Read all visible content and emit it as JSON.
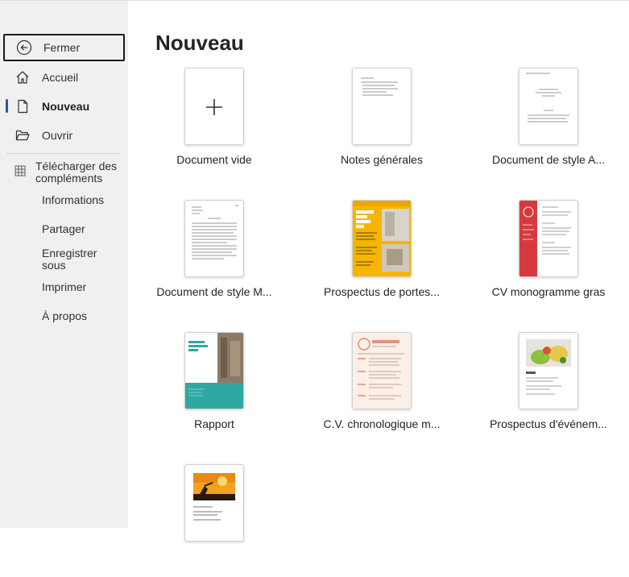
{
  "sidebar": {
    "items": [
      {
        "label": "Fermer",
        "icon": "back-arrow-icon"
      },
      {
        "label": "Accueil",
        "icon": "home-icon"
      },
      {
        "label": "Nouveau",
        "icon": "new-document-icon"
      },
      {
        "label": "Ouvrir",
        "icon": "folder-open-icon"
      }
    ],
    "addins": {
      "label": "Télécharger des compléments",
      "icon": "addins-grid-icon"
    },
    "secondary": [
      "Informations",
      "Partager",
      "Enregistrer sous",
      "Imprimer",
      "À propos"
    ]
  },
  "main": {
    "title": "Nouveau",
    "templates": [
      {
        "name": "Document vide"
      },
      {
        "name": "Notes générales"
      },
      {
        "name": "Document de style A..."
      },
      {
        "name": "Document de style M..."
      },
      {
        "name": "Prospectus de portes..."
      },
      {
        "name": "CV monogramme gras"
      },
      {
        "name": "Rapport"
      },
      {
        "name": "C.V. chronologique m..."
      },
      {
        "name": "Prospectus d'événem..."
      },
      {
        "name": ""
      }
    ]
  },
  "colors": {
    "sidebar_bg": "#f0f0f0",
    "accent": "#2b579a",
    "flyer_yellow": "#f5b500",
    "cv_red": "#d63a3f",
    "report_teal": "#2fa7a3"
  }
}
